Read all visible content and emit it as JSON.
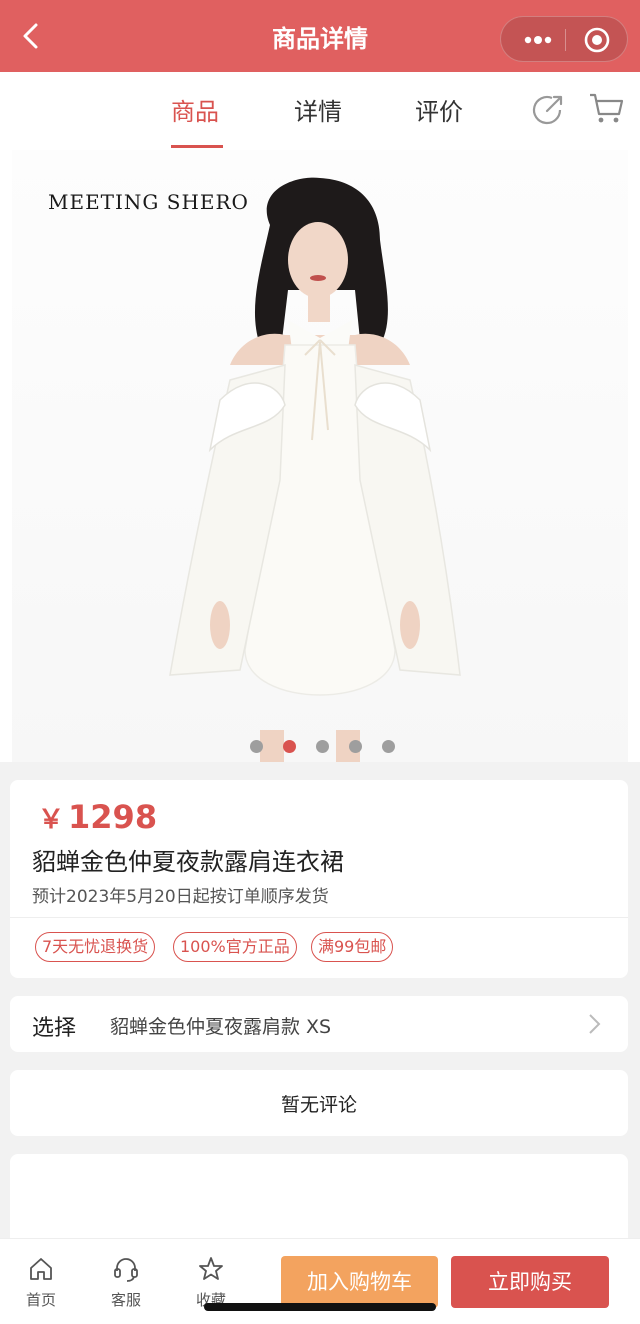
{
  "header": {
    "title": "商品详情"
  },
  "tabs": [
    {
      "label": "商品",
      "active": true
    },
    {
      "label": "详情",
      "active": false
    },
    {
      "label": "评价",
      "active": false
    }
  ],
  "hero": {
    "brand": "MEETING SHERO",
    "slide_count": 5,
    "active_slide": 2
  },
  "product": {
    "currency": "￥",
    "price": "1298",
    "name": "貂蝉金色仲夏夜款露肩连衣裙",
    "shipping_note": "预计2023年5月20日起按订单顺序发货",
    "tags": [
      "7天无忧退换货",
      "100%官方正品",
      "满99包邮"
    ]
  },
  "option": {
    "label": "选择",
    "value": "貂蝉金色仲夏夜露肩款 XS"
  },
  "review": {
    "empty_text": "暂无评论"
  },
  "bottom": {
    "nav": [
      {
        "label": "首页",
        "icon": "home-icon"
      },
      {
        "label": "客服",
        "icon": "headset-icon"
      },
      {
        "label": "收藏",
        "icon": "star-icon"
      }
    ],
    "add_to_cart": "加入购物车",
    "buy_now": "立即购买"
  },
  "colors": {
    "header": "#e06060",
    "accent": "#d9534f",
    "cart_button": "#f3a35f"
  }
}
